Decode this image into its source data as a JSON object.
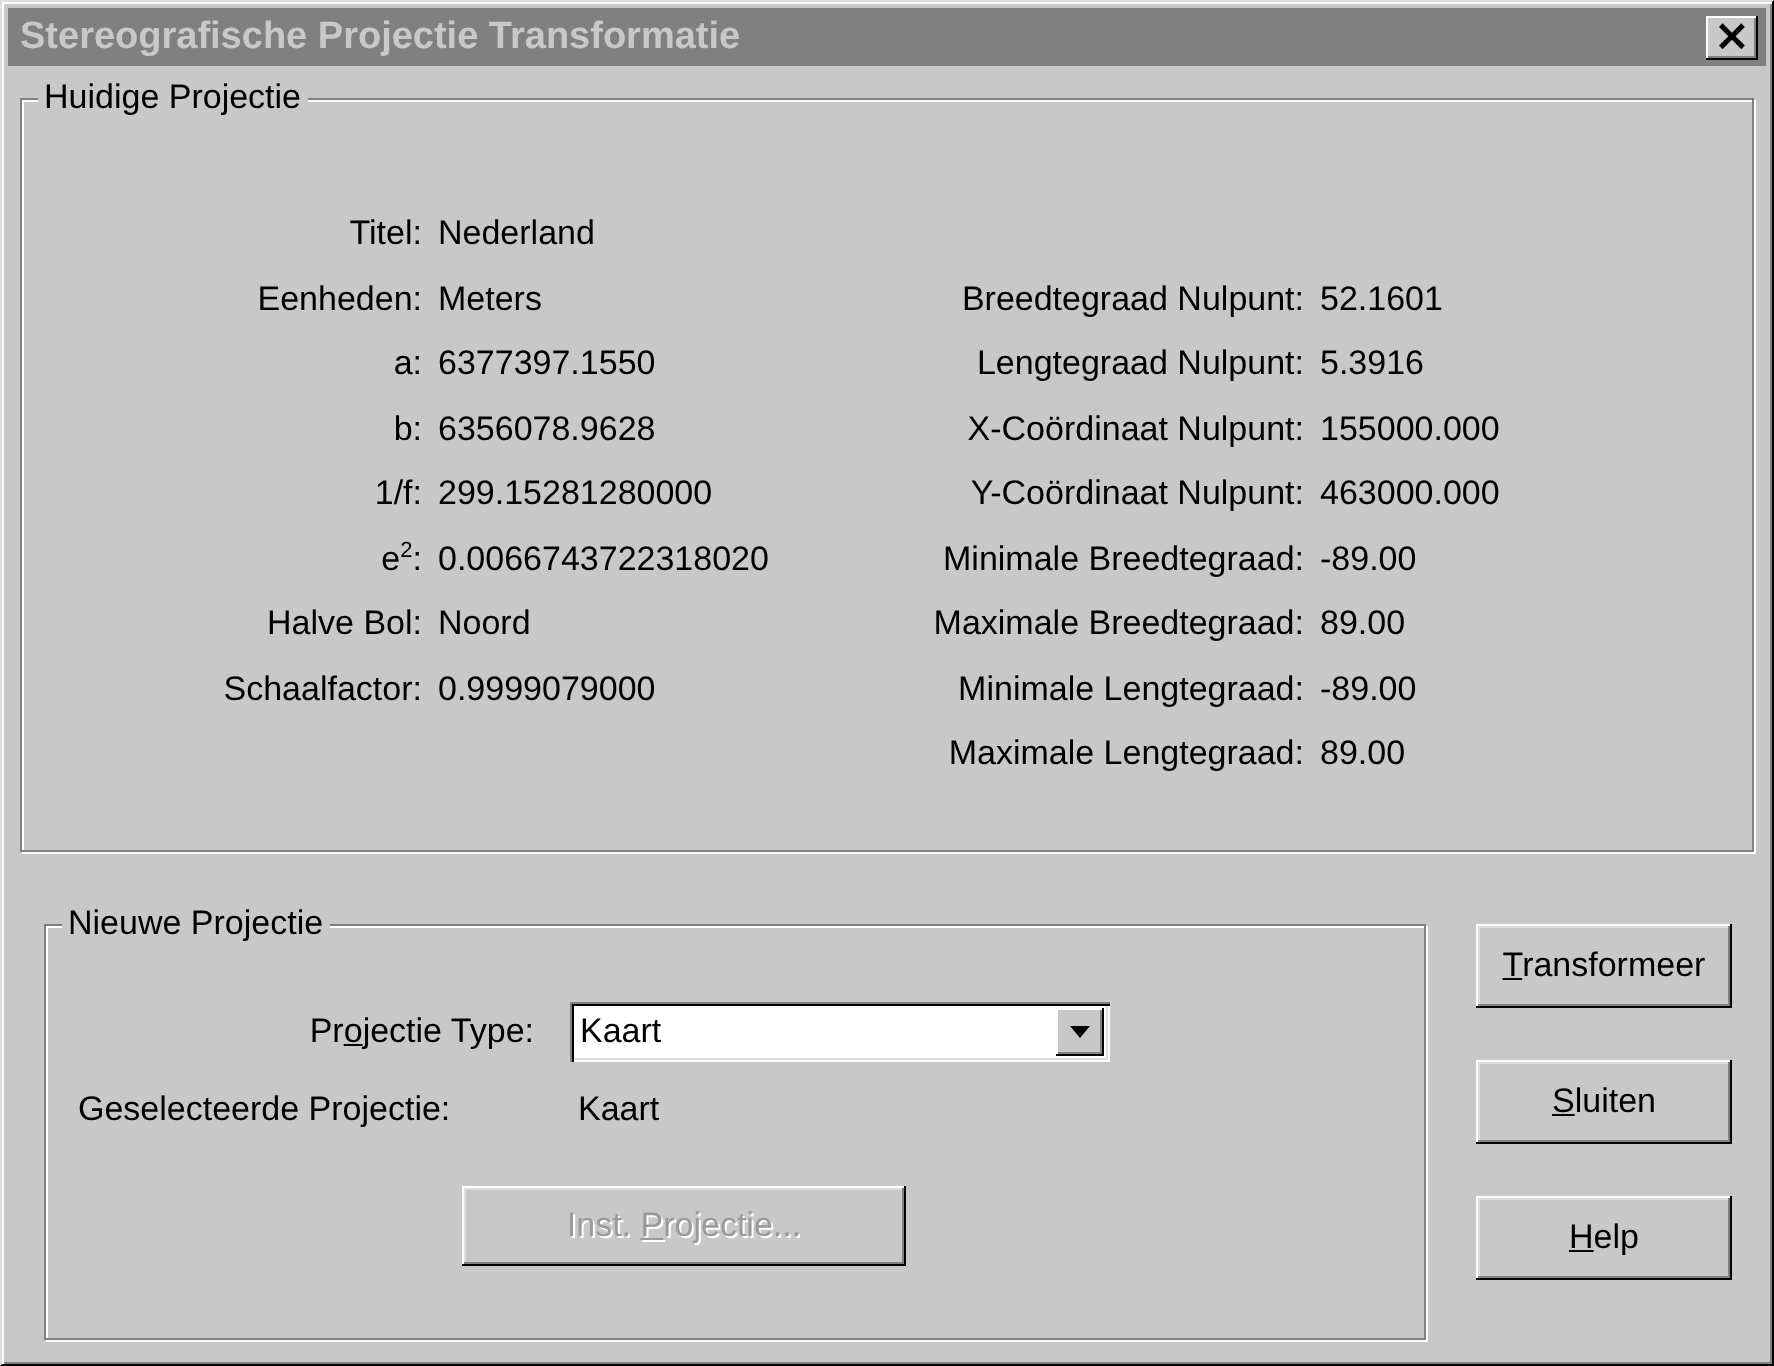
{
  "window": {
    "title": "Stereografische Projectie Transformatie",
    "active": false,
    "close": "×"
  },
  "current_projection": {
    "title": "Huidige Projectie",
    "left_fields": [
      {
        "label": "Titel:",
        "value": "Nederland"
      },
      {
        "label": "Eenheden:",
        "value": "Meters"
      },
      {
        "label": "a:",
        "value": "6377397.1550"
      },
      {
        "label": "b:",
        "value": "6356078.9628"
      },
      {
        "label": "1/f:",
        "value": "299.15281280000"
      },
      {
        "label": "e$^{2}$:",
        "value": "0.0066743722318020"
      },
      {
        "label": "Halve Bol:",
        "value": "Noord"
      },
      {
        "label": "Schaalfactor:",
        "value": "0.9999079000"
      }
    ],
    "right_fields": [
      {
        "label": "Breedtegraad Nulpunt:",
        "value": "52.1601"
      },
      {
        "label": "Lengtegraad Nulpunt:",
        "value": "5.3916"
      },
      {
        "label": "X-Coördinaat Nulpunt:",
        "value": "155000.000"
      },
      {
        "label": "Y-Coördinaat Nulpunt:",
        "value": "463000.000"
      },
      {
        "label": "Minimale Breedtegraad:",
        "value": "-89.00"
      },
      {
        "label": "Maximale Breedtegraad:",
        "value": "89.00"
      },
      {
        "label": "Minimale Lengtegraad:",
        "value": "-89.00"
      },
      {
        "label": "Maximale Lengtegraad:",
        "value": "89.00"
      }
    ]
  },
  "new_projection": {
    "title": "Nieuwe Projectie",
    "type_label": {
      "before": "Pr",
      "access_key": "o",
      "after": "jectie Type:"
    },
    "type_dropdown": {
      "value": "Kaart"
    },
    "selected_label": "Geselecteerde Projectie:",
    "selected_value": "Kaart",
    "settings_button": {
      "before": "Inst. ",
      "access_key": "P",
      "after": "rojectie...",
      "disabled": true
    }
  },
  "buttons": [
    {
      "access_key": "T",
      "after": "ransformeer",
      "disabled": false
    },
    {
      "access_key": "S",
      "after": "luiten",
      "disabled": false
    },
    {
      "access_key": "H",
      "after": "elp",
      "disabled": false
    }
  ]
}
